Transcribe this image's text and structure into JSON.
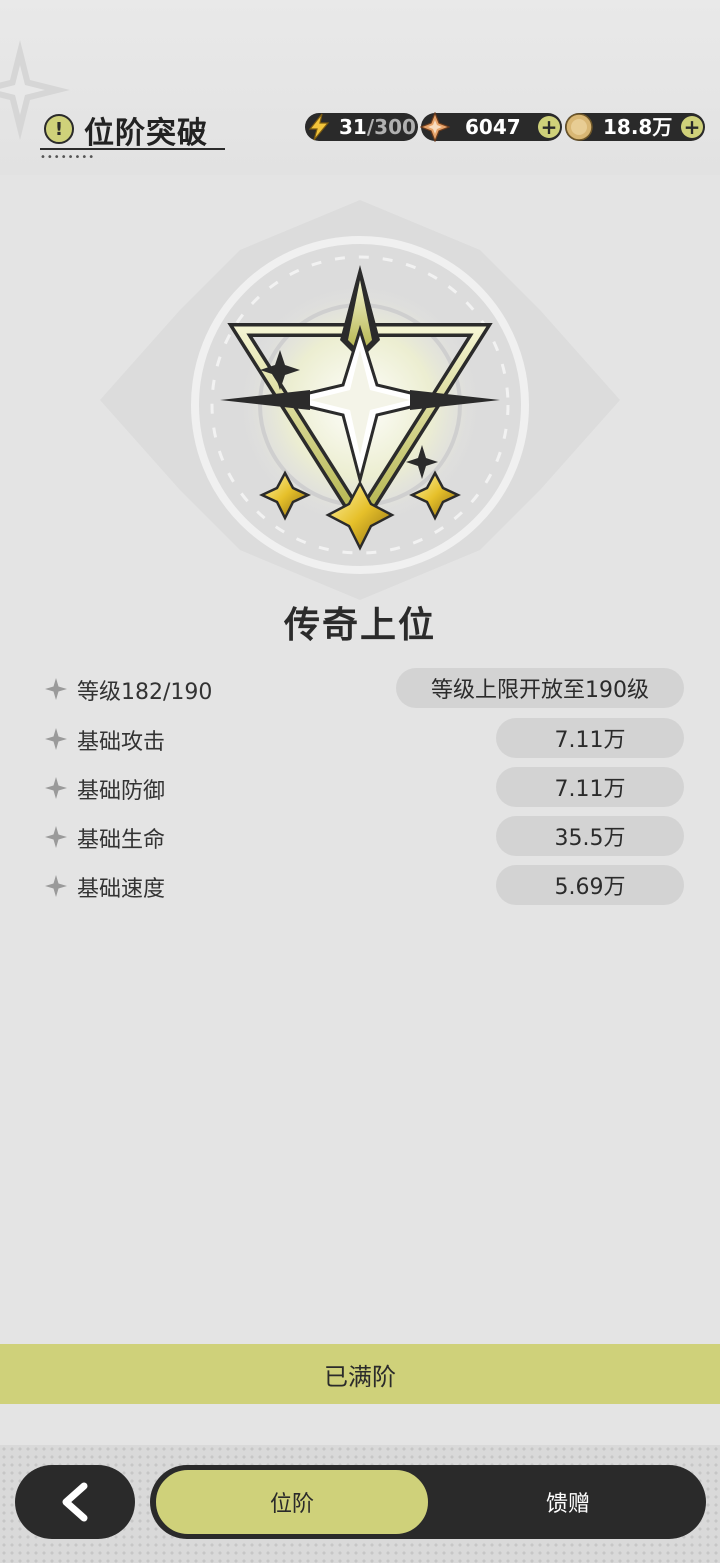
{
  "header": {
    "title": "位阶突破",
    "resources": {
      "energy": {
        "current": "31",
        "max": "/300"
      },
      "gems": "6047",
      "coins": "18.8万"
    }
  },
  "rank": {
    "name": "传奇上位"
  },
  "stats": [
    {
      "label": "等级182/190",
      "value": "等级上限开放至190级"
    },
    {
      "label": "基础攻击",
      "value": "7.11万"
    },
    {
      "label": "基础防御",
      "value": "7.11万"
    },
    {
      "label": "基础生命",
      "value": "35.5万"
    },
    {
      "label": "基础速度",
      "value": "5.69万"
    }
  ],
  "max_bar": {
    "label": "已满阶"
  },
  "tabs": [
    {
      "label": "位阶",
      "active": true
    },
    {
      "label": "馈赠",
      "active": false
    }
  ],
  "colors": {
    "accent": "#cfd17a",
    "dark": "#2a2a2a",
    "background": "#e4e4e4"
  }
}
